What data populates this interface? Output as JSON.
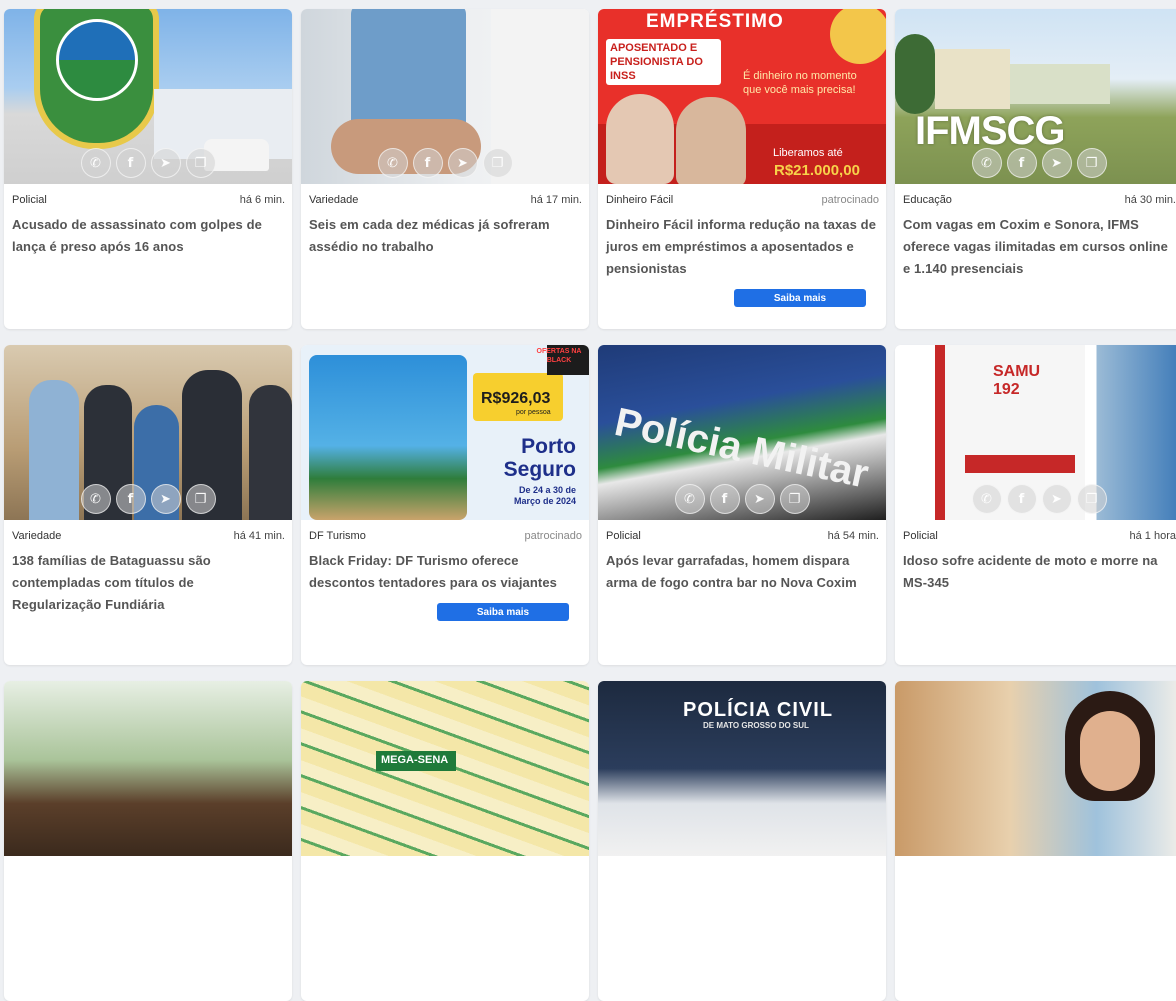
{
  "share_icons": [
    "whatsapp-icon",
    "facebook-icon",
    "telegram-icon",
    "copy-icon"
  ],
  "cards": [
    {
      "category": "Policial",
      "time": "há 6 min.",
      "title": "Acusado de assassinato com golpes de lança é preso após 16 anos",
      "share": true
    },
    {
      "category": "Variedade",
      "time": "há 17 min.",
      "title": "Seis em cada dez médicas já sofreram assédio no trabalho",
      "share": true
    },
    {
      "category": "Dinheiro Fácil",
      "time": "patrocinado",
      "sponsored": true,
      "title": "Dinheiro Fácil informa redução na taxas de juros em empréstimos a aposentados e pensionistas",
      "cta": "Saiba mais",
      "share": false,
      "image_text": {
        "headline": "EMPRÉSTIMO",
        "sub": "APOSENTADO E PENSIONISTA DO INSS",
        "tagline": "É dinheiro no momento que você mais precisa!",
        "offer": "Liberamos até",
        "amount": "R$21.000,00"
      }
    },
    {
      "category": "Educação",
      "time": "há 30 min.",
      "title": "Com vagas em Coxim e Sonora, IFMS oferece vagas ilimitadas em cursos online e 1.140 presenciais",
      "share": true,
      "image_text": {
        "sign": "IFMSCG"
      }
    },
    {
      "category": "Variedade",
      "time": "há 41 min.",
      "title": "138 famílias de Bataguassu são contempladas com títulos de Regularização Fundiária",
      "share": true
    },
    {
      "category": "DF Turismo",
      "time": "patrocinado",
      "sponsored": true,
      "title": "Black Friday: DF Turismo oferece descontos tentadores para os viajantes",
      "cta": "Saiba mais",
      "share": false,
      "image_text": {
        "badge": "OFERTAS NA BLACK",
        "price": "R$926,03",
        "price_note": "por pessoa",
        "destination": "Porto Seguro",
        "dates": "De 24 a 30 de Março de 2024"
      }
    },
    {
      "category": "Policial",
      "time": "há 54 min.",
      "title": "Após levar garrafadas, homem dispara arma de fogo contra bar no Nova Coxim",
      "share": true,
      "image_text": {
        "sign": "Polícia Militar"
      }
    },
    {
      "category": "Policial",
      "time": "há 1 hora",
      "title": "Idoso sofre acidente de moto e morre na MS-345",
      "share": true,
      "image_text": {
        "sign": "SAMU 192"
      }
    },
    {
      "category": "",
      "time": "",
      "title": "",
      "share": false
    },
    {
      "category": "",
      "time": "",
      "title": "",
      "share": false,
      "image_text": {
        "sign": "MEGA-SENA"
      }
    },
    {
      "category": "",
      "time": "",
      "title": "",
      "share": false,
      "image_text": {
        "sign": "POLÍCIA CIVIL",
        "sub": "DE MATO GROSSO DO SUL"
      }
    },
    {
      "category": "",
      "time": "",
      "title": "",
      "share": false
    }
  ]
}
